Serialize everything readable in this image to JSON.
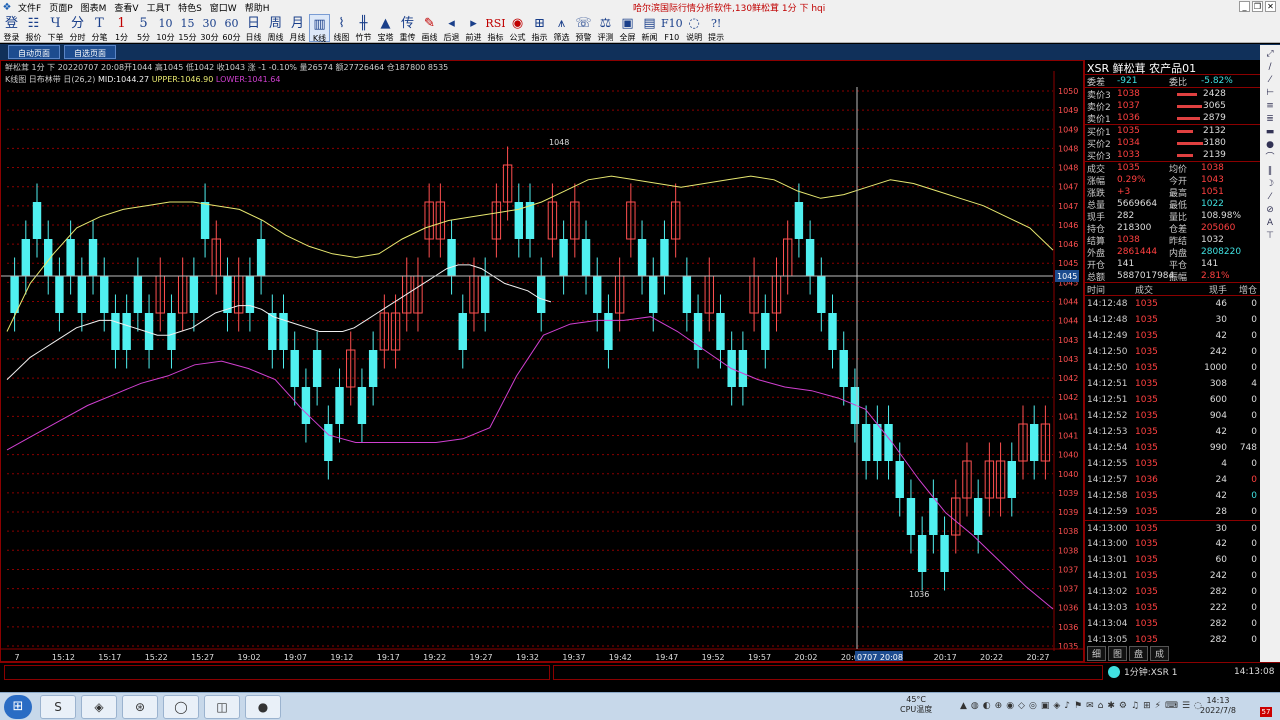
{
  "menubar": {
    "items": [
      "文件F",
      "页面P",
      "图表M",
      "查看V",
      "工具T",
      "特色S",
      "窗口W",
      "帮助H"
    ],
    "title": "哈尔滨国际行情分析软件,130鲜松茸 1分 下 hqi"
  },
  "toolbar": [
    {
      "g": "登",
      "l": "登录"
    },
    {
      "g": "☷",
      "l": "报价"
    },
    {
      "g": "Ч",
      "l": "下单"
    },
    {
      "g": "分",
      "l": "分时"
    },
    {
      "g": "T",
      "l": "分笔"
    },
    {
      "g": "1",
      "l": "1分",
      "red": true
    },
    {
      "g": "5",
      "l": "5分"
    },
    {
      "g": "10",
      "l": "10分"
    },
    {
      "g": "15",
      "l": "15分"
    },
    {
      "g": "30",
      "l": "30分"
    },
    {
      "g": "60",
      "l": "60分"
    },
    {
      "g": "日",
      "l": "日线"
    },
    {
      "g": "周",
      "l": "周线"
    },
    {
      "g": "月",
      "l": "月线"
    },
    {
      "g": "▥",
      "l": "K线",
      "sel": true
    },
    {
      "g": "⌇",
      "l": "线图"
    },
    {
      "g": "╫",
      "l": "竹节"
    },
    {
      "g": "▲",
      "l": "宝塔"
    },
    {
      "g": "传",
      "l": "重传"
    },
    {
      "g": "✎",
      "l": "画线",
      "red": true
    },
    {
      "g": "◂",
      "l": "后退"
    },
    {
      "g": "▸",
      "l": "前进"
    },
    {
      "g": "RSI",
      "l": "指标",
      "red": true
    },
    {
      "g": "◉",
      "l": "公式",
      "red": true
    },
    {
      "g": "⊞",
      "l": "指示"
    },
    {
      "g": "⩚",
      "l": "筛选"
    },
    {
      "g": "☏",
      "l": "预警"
    },
    {
      "g": "⚖",
      "l": "评测"
    },
    {
      "g": "▣",
      "l": "全屏"
    },
    {
      "g": "▤",
      "l": "新闻"
    },
    {
      "g": "F10",
      "l": "F10"
    },
    {
      "g": "◌",
      "l": "说明"
    },
    {
      "g": "?!",
      "l": "提示"
    }
  ],
  "pagetabs": [
    "自动页面",
    "自选页面"
  ],
  "chart": {
    "info1": "鲜松茸 1分 下 20220707 20:08开1044 高1045 低1042 收1043 涨 -1 -0.10% 量26574 额27726464 仓187800 8535",
    "info2_name": "K线图 日布林带 日(26,2)",
    "info2_mid": "MID:1044.27",
    "info2_upper": "UPPER:1046.90",
    "info2_lower": "LOWER:1041.64",
    "crosshair_price": "1045",
    "crosshair_time": "0707 20:08",
    "annot_high": "1048",
    "annot_low": "1036",
    "colors": {
      "up": "#ff5050",
      "down": "#50f0f0",
      "mid": "#f0f0f0",
      "upper": "#e8e870",
      "lower": "#d040d0",
      "grid": "#8b0000"
    }
  },
  "chart_data": {
    "type": "candlestick",
    "ylim": [
      1035,
      1050
    ],
    "y_ticks": [
      "1050",
      "1049",
      "1049",
      "1048",
      "1048",
      "1047",
      "1047",
      "1046",
      "1046",
      "1045",
      "1045",
      "1044",
      "1044",
      "1043",
      "1043",
      "1042",
      "1042",
      "1041",
      "1041",
      "1040",
      "1040",
      "1039",
      "1039",
      "1038",
      "1038",
      "1037",
      "1037",
      "1036",
      "1036",
      "1035"
    ],
    "x_ticks": [
      "7",
      "15:12",
      "15:17",
      "15:22",
      "15:27",
      "19:02",
      "19:07",
      "19:12",
      "19:17",
      "19:22",
      "19:27",
      "19:32",
      "19:37",
      "19:42",
      "19:47",
      "19:52",
      "19:57",
      "20:02",
      "20:07",
      "",
      "20:17",
      "20:22",
      "20:27"
    ],
    "candles": [
      {
        "o": 1045,
        "c": 1044
      },
      {
        "o": 1046,
        "c": 1045
      },
      {
        "o": 1047,
        "c": 1046
      },
      {
        "o": 1046,
        "c": 1045
      },
      {
        "o": 1045,
        "c": 1044
      },
      {
        "o": 1046,
        "c": 1045
      },
      {
        "o": 1045,
        "c": 1044
      },
      {
        "o": 1046,
        "c": 1045
      },
      {
        "o": 1045,
        "c": 1044
      },
      {
        "o": 1044,
        "c": 1043
      },
      {
        "o": 1044,
        "c": 1043
      },
      {
        "o": 1045,
        "c": 1044
      },
      {
        "o": 1044,
        "c": 1043
      },
      {
        "o": 1044,
        "c": 1045
      },
      {
        "o": 1044,
        "c": 1043
      },
      {
        "o": 1044,
        "c": 1045
      },
      {
        "o": 1045,
        "c": 1044
      },
      {
        "o": 1047,
        "c": 1046
      },
      {
        "o": 1045,
        "c": 1046
      },
      {
        "o": 1045,
        "c": 1044
      },
      {
        "o": 1044,
        "c": 1045
      },
      {
        "o": 1045,
        "c": 1044
      },
      {
        "o": 1046,
        "c": 1045
      },
      {
        "o": 1044,
        "c": 1043
      },
      {
        "o": 1044,
        "c": 1043
      },
      {
        "o": 1043,
        "c": 1042
      },
      {
        "o": 1042,
        "c": 1041
      },
      {
        "o": 1043,
        "c": 1042
      },
      {
        "o": 1041,
        "c": 1040
      },
      {
        "o": 1042,
        "c": 1041
      },
      {
        "o": 1042,
        "c": 1043
      },
      {
        "o": 1042,
        "c": 1041
      },
      {
        "o": 1043,
        "c": 1042
      },
      {
        "o": 1043,
        "c": 1044
      },
      {
        "o": 1043,
        "c": 1044
      },
      {
        "o": 1044,
        "c": 1045
      },
      {
        "o": 1044,
        "c": 1045
      },
      {
        "o": 1046,
        "c": 1047
      },
      {
        "o": 1046,
        "c": 1047
      },
      {
        "o": 1046,
        "c": 1045
      },
      {
        "o": 1044,
        "c": 1043
      },
      {
        "o": 1044,
        "c": 1045
      },
      {
        "o": 1045,
        "c": 1044
      },
      {
        "o": 1046,
        "c": 1047
      },
      {
        "o": 1047,
        "c": 1048
      },
      {
        "o": 1047,
        "c": 1046
      },
      {
        "o": 1047,
        "c": 1046
      },
      {
        "o": 1045,
        "c": 1044
      },
      {
        "o": 1046,
        "c": 1047
      },
      {
        "o": 1046,
        "c": 1045
      },
      {
        "o": 1046,
        "c": 1047
      },
      {
        "o": 1046,
        "c": 1045
      },
      {
        "o": 1045,
        "c": 1044
      },
      {
        "o": 1044,
        "c": 1043
      },
      {
        "o": 1044,
        "c": 1045
      },
      {
        "o": 1046,
        "c": 1047
      },
      {
        "o": 1046,
        "c": 1045
      },
      {
        "o": 1045,
        "c": 1044
      },
      {
        "o": 1046,
        "c": 1045
      },
      {
        "o": 1046,
        "c": 1047
      },
      {
        "o": 1045,
        "c": 1044
      },
      {
        "o": 1044,
        "c": 1043
      },
      {
        "o": 1044,
        "c": 1045
      },
      {
        "o": 1044,
        "c": 1043
      },
      {
        "o": 1043,
        "c": 1042
      },
      {
        "o": 1043,
        "c": 1042
      },
      {
        "o": 1044,
        "c": 1045
      },
      {
        "o": 1044,
        "c": 1043
      },
      {
        "o": 1044,
        "c": 1045
      },
      {
        "o": 1045,
        "c": 1046
      },
      {
        "o": 1047,
        "c": 1046
      },
      {
        "o": 1046,
        "c": 1045
      },
      {
        "o": 1045,
        "c": 1044
      },
      {
        "o": 1044,
        "c": 1043
      },
      {
        "o": 1043,
        "c": 1042
      },
      {
        "o": 1042,
        "c": 1041
      },
      {
        "o": 1041,
        "c": 1040
      },
      {
        "o": 1041,
        "c": 1040
      },
      {
        "o": 1041,
        "c": 1040
      },
      {
        "o": 1040,
        "c": 1039
      },
      {
        "o": 1039,
        "c": 1038
      },
      {
        "o": 1038,
        "c": 1037
      },
      {
        "o": 1039,
        "c": 1038
      },
      {
        "o": 1038,
        "c": 1037
      },
      {
        "o": 1038,
        "c": 1039
      },
      {
        "o": 1039,
        "c": 1040
      },
      {
        "o": 1039,
        "c": 1038
      },
      {
        "o": 1039,
        "c": 1040
      },
      {
        "o": 1039,
        "c": 1040
      },
      {
        "o": 1040,
        "c": 1039
      },
      {
        "o": 1040,
        "c": 1041
      },
      {
        "o": 1041,
        "c": 1040
      },
      {
        "o": 1040,
        "c": 1041
      }
    ],
    "series": [
      {
        "name": "MID",
        "values": [
          1042.2,
          1042.5,
          1042.8,
          1043,
          1043.2,
          1043.4,
          1043.6,
          1043.7,
          1043.8,
          1043.8,
          1043.7,
          1043.6,
          1043.5,
          1043.4,
          1043.4,
          1043.5,
          1043.6,
          1043.8,
          1044,
          1044.1,
          1044.2,
          1044.2,
          1044.1,
          1043.9,
          1043.8,
          1043.7,
          1043.6,
          1043.5,
          1043.5,
          1043.5,
          1043.6,
          1043.8,
          1044,
          1044.2,
          1044.4,
          1044.6,
          1044.8,
          1045,
          1045.2,
          1045.3,
          1045.3,
          1045.2,
          1045,
          1044.8,
          1044.7,
          1044.6,
          1044.4,
          1044.3
        ],
        "extent": [
          0,
          0.52
        ]
      },
      {
        "name": "UPPER",
        "values": [
          1043.5,
          1044.8,
          1045.6,
          1046.3,
          1046.6,
          1046.8,
          1046.9,
          1047,
          1047,
          1046.9,
          1046.8,
          1046.5,
          1046.1,
          1045.8,
          1045.6,
          1045.5,
          1045.6,
          1046,
          1046.3,
          1046.5,
          1046.6,
          1046.7,
          1046.8,
          1047,
          1047.3,
          1047.6,
          1047.7,
          1047.6,
          1047.5,
          1047.4,
          1047.5,
          1047.6,
          1047.7,
          1047.6,
          1047.3,
          1047.1,
          1047.2,
          1047.4,
          1047.6,
          1047.5,
          1047.3,
          1047.1,
          1046.9,
          1046.6,
          1046.3,
          1045.7
        ],
        "extent": [
          0,
          1
        ]
      },
      {
        "name": "LOWER",
        "values": [
          1040.3,
          1040.7,
          1041.1,
          1041.5,
          1041.8,
          1042.1,
          1042.3,
          1042.6,
          1042.7,
          1042.5,
          1042.2,
          1041.4,
          1040.7,
          1040.5,
          1040.5,
          1040.5,
          1040.5,
          1040.6,
          1040.9,
          1042.3,
          1043.4,
          1043.7,
          1043.8,
          1043.8,
          1043.9,
          1043.5,
          1043,
          1042.5,
          1042.2,
          1042,
          1041.9,
          1041.7,
          1041.4,
          1040.5,
          1039.5,
          1038.6,
          1038,
          1037.3,
          1036.6,
          1036
        ],
        "extent": [
          0,
          1
        ]
      }
    ]
  },
  "quote": {
    "header": "XSR  鲜松茸   农产品01",
    "wb": {
      "l1": "委差",
      "v1": "-921",
      "l2": "委比",
      "v2": "-5.82%"
    },
    "asks": [
      {
        "l": "卖价3",
        "p": "1038",
        "q": "2428",
        "bar": 0.55
      },
      {
        "l": "卖价2",
        "p": "1037",
        "q": "3065",
        "bar": 0.7
      },
      {
        "l": "卖价1",
        "p": "1036",
        "q": "2879",
        "bar": 0.65
      }
    ],
    "bids": [
      {
        "l": "买价1",
        "p": "1035",
        "q": "2132",
        "bar": 0.45
      },
      {
        "l": "买价2",
        "p": "1034",
        "q": "3180",
        "bar": 0.72
      },
      {
        "l": "买价3",
        "p": "1033",
        "q": "2139",
        "bar": 0.45
      }
    ],
    "stats": [
      {
        "l1": "成交",
        "v1": "1035",
        "c1": "red",
        "l2": "均价",
        "v2": "1038",
        "c2": "red"
      },
      {
        "l1": "涨幅",
        "v1": "0.29%",
        "c1": "red",
        "l2": "今开",
        "v2": "1043",
        "c2": "red"
      },
      {
        "l1": "涨跌",
        "v1": "+3",
        "c1": "red",
        "l2": "最高",
        "v2": "1051",
        "c2": "red"
      },
      {
        "l1": "总量",
        "v1": "5669664",
        "c1": "wht",
        "l2": "最低",
        "v2": "1022",
        "c2": "grn"
      },
      {
        "l1": "现手",
        "v1": "282",
        "c1": "wht",
        "l2": "量比",
        "v2": "108.98%",
        "c2": "wht"
      },
      {
        "l1": "持仓",
        "v1": "218300",
        "c1": "wht",
        "l2": "仓差",
        "v2": "205060",
        "c2": "red"
      },
      {
        "l1": "结算",
        "v1": "1038",
        "c1": "red",
        "l2": "昨结",
        "v2": "1032",
        "c2": "wht"
      },
      {
        "l1": "外盘",
        "v1": "2861444",
        "c1": "red",
        "l2": "内盘",
        "v2": "2808220",
        "c2": "grn"
      },
      {
        "l1": "开仓",
        "v1": "141",
        "c1": "wht",
        "l2": "平仓",
        "v2": "141",
        "c2": "wht"
      },
      {
        "l1": "总额",
        "v1": "5887017984",
        "c1": "wht",
        "l2": "振幅",
        "v2": "2.81%",
        "c2": "red"
      }
    ],
    "ticks_header": [
      "时间",
      "成交",
      "现手",
      "增仓"
    ],
    "ticks": [
      {
        "t": "14:12:48",
        "p": "1035",
        "pc": "red",
        "v": "46",
        "f": "0",
        "fc": "wht"
      },
      {
        "t": "14:12:48",
        "p": "1035",
        "pc": "red",
        "v": "30",
        "f": "0",
        "fc": "wht"
      },
      {
        "t": "14:12:49",
        "p": "1035",
        "pc": "red",
        "v": "42",
        "f": "0",
        "fc": "wht"
      },
      {
        "t": "14:12:50",
        "p": "1035",
        "pc": "red",
        "v": "242",
        "f": "0",
        "fc": "wht"
      },
      {
        "t": "14:12:50",
        "p": "1035",
        "pc": "red",
        "v": "1000",
        "f": "0",
        "fc": "wht"
      },
      {
        "t": "14:12:51",
        "p": "1035",
        "pc": "red",
        "v": "308",
        "f": "4",
        "fc": "wht"
      },
      {
        "t": "14:12:51",
        "p": "1035",
        "pc": "red",
        "v": "600",
        "f": "0",
        "fc": "wht"
      },
      {
        "t": "14:12:52",
        "p": "1035",
        "pc": "red",
        "v": "904",
        "f": "0",
        "fc": "wht"
      },
      {
        "t": "14:12:53",
        "p": "1035",
        "pc": "red",
        "v": "42",
        "f": "0",
        "fc": "wht"
      },
      {
        "t": "14:12:54",
        "p": "1035",
        "pc": "red",
        "v": "990",
        "f": "748",
        "fc": "wht"
      },
      {
        "t": "14:12:55",
        "p": "1035",
        "pc": "red",
        "v": "4",
        "f": "0",
        "fc": "wht"
      },
      {
        "t": "14:12:57",
        "p": "1036",
        "pc": "red",
        "v": "24",
        "f": "0",
        "fc": "red"
      },
      {
        "t": "14:12:58",
        "p": "1035",
        "pc": "red",
        "v": "42",
        "f": "0",
        "fc": "grn"
      },
      {
        "t": "14:12:59",
        "p": "1035",
        "pc": "red",
        "v": "28",
        "f": "0",
        "fc": "wht"
      },
      {
        "t": "14:13:00",
        "p": "1035",
        "pc": "red",
        "v": "30",
        "f": "0",
        "fc": "wht"
      },
      {
        "t": "14:13:00",
        "p": "1035",
        "pc": "red",
        "v": "42",
        "f": "0",
        "fc": "wht"
      },
      {
        "t": "14:13:01",
        "p": "1035",
        "pc": "red",
        "v": "60",
        "f": "0",
        "fc": "wht"
      },
      {
        "t": "14:13:01",
        "p": "1035",
        "pc": "red",
        "v": "242",
        "f": "0",
        "fc": "wht"
      },
      {
        "t": "14:13:02",
        "p": "1035",
        "pc": "red",
        "v": "282",
        "f": "0",
        "fc": "wht"
      },
      {
        "t": "14:13:03",
        "p": "1035",
        "pc": "red",
        "v": "222",
        "f": "0",
        "fc": "wht"
      },
      {
        "t": "14:13:04",
        "p": "1035",
        "pc": "red",
        "v": "282",
        "f": "0",
        "fc": "wht"
      },
      {
        "t": "14:13:05",
        "p": "1035",
        "pc": "red",
        "v": "282",
        "f": "0",
        "fc": "wht"
      }
    ],
    "tabs": [
      "细",
      "图",
      "盘",
      "成"
    ]
  },
  "sidetools": [
    "⤢",
    "∕",
    "⁄",
    "⊢",
    "≡",
    "≣",
    "▬",
    "●",
    "⌒",
    "‖",
    "☽",
    "⁄",
    "⊘",
    "A",
    "⊤"
  ],
  "status": {
    "indicator": "1分钟:XSR 1",
    "time": "14:13:08"
  },
  "taskbar": {
    "apps": [
      "S",
      "◈",
      "⊛",
      "◯",
      "◫",
      "●"
    ],
    "weather_temp": "45°C",
    "weather_label": "CPU温度",
    "clock_time": "14:13",
    "clock_date": "2022/7/8",
    "badge": "57"
  }
}
